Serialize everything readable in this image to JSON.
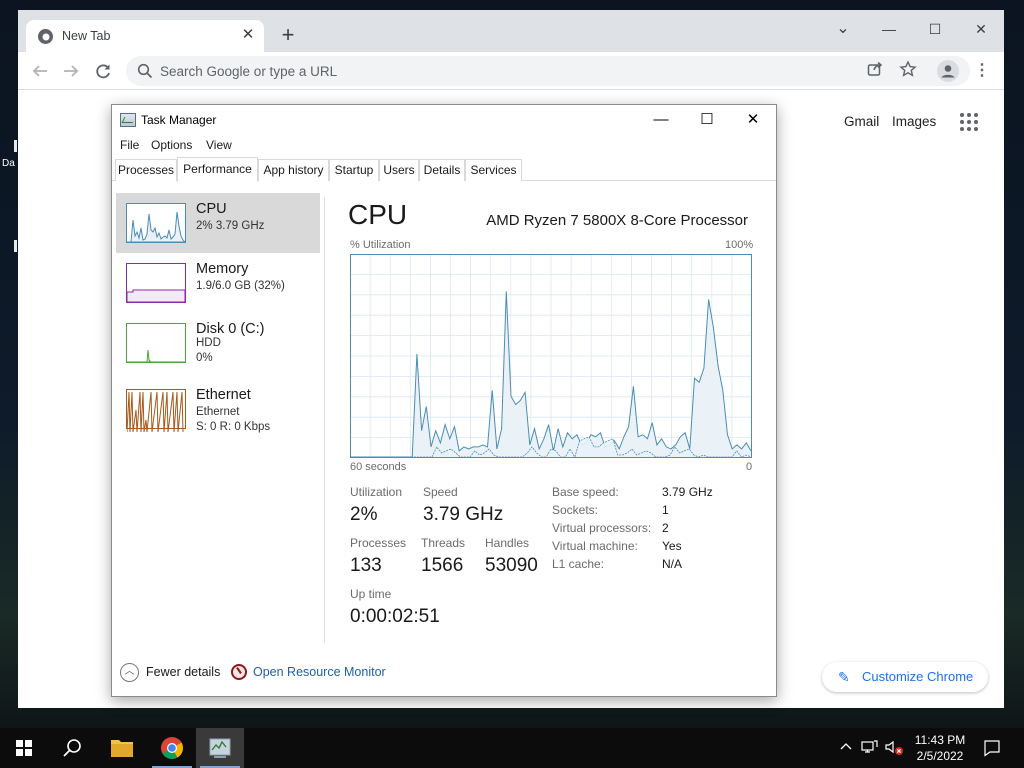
{
  "desktop": {
    "fragment_text": "Da"
  },
  "chrome": {
    "tab_title": "New Tab",
    "tab_close": "✕",
    "new_tab": "+",
    "omnibox_placeholder": "Search Google or type a URL",
    "links": {
      "gmail": "Gmail",
      "images": "Images"
    },
    "customize_label": "Customize Chrome",
    "window_controls": {
      "dropdown": "⌄",
      "minimize": "—",
      "maximize": "☐",
      "close": "✕"
    }
  },
  "task_manager": {
    "title": "Task Manager",
    "menu": [
      "File",
      "Options",
      "View"
    ],
    "tabs": [
      "Processes",
      "Performance",
      "App history",
      "Startup",
      "Users",
      "Details",
      "Services"
    ],
    "active_tab": "Performance",
    "sidebar": [
      {
        "name": "CPU",
        "sub1": "2%  3.79 GHz",
        "sub2": ""
      },
      {
        "name": "Memory",
        "sub1": "1.9/6.0 GB (32%)",
        "sub2": ""
      },
      {
        "name": "Disk 0 (C:)",
        "sub1": "HDD",
        "sub2": "0%"
      },
      {
        "name": "Ethernet",
        "sub1": "Ethernet",
        "sub2": "S: 0 R: 0 Kbps"
      }
    ],
    "cpu": {
      "title": "CPU",
      "model": "AMD Ryzen 7 5800X 8-Core Processor",
      "graph_ylabel": "% Utilization",
      "graph_ymax_label": "100%",
      "graph_xleft_label": "60 seconds",
      "graph_xright_label": "0",
      "stats": {
        "utilization_label": "Utilization",
        "utilization": "2%",
        "speed_label": "Speed",
        "speed": "3.79 GHz",
        "processes_label": "Processes",
        "processes": "133",
        "threads_label": "Threads",
        "threads": "1566",
        "handles_label": "Handles",
        "handles": "53090",
        "uptime_label": "Up time",
        "uptime": "0:00:02:51"
      },
      "details": [
        {
          "label": "Base speed:",
          "value": "3.79 GHz"
        },
        {
          "label": "Sockets:",
          "value": "1"
        },
        {
          "label": "Virtual processors:",
          "value": "2"
        },
        {
          "label": "Virtual machine:",
          "value": "Yes"
        },
        {
          "label": "L1 cache:",
          "value": "N/A"
        }
      ]
    },
    "footer": {
      "fewer_details": "Fewer details",
      "resource_monitor": "Open Resource Monitor"
    }
  },
  "taskbar": {
    "time": "11:43 PM",
    "date": "2/5/2022"
  },
  "colors": {
    "cpu_line": "#4a8db5",
    "cpu_fill": "#eaf2f8",
    "memory": "#8b2aa7",
    "disk": "#4ca33c",
    "ethernet": "#a65a1c",
    "link": "#1a73e8"
  },
  "chart_data": {
    "type": "area",
    "ylabel": "% Utilization",
    "xlabel": "60 seconds",
    "ylim": [
      0,
      100
    ],
    "series": [
      {
        "name": "",
        "values": [
          0,
          0,
          0,
          0,
          0,
          0,
          0,
          0,
          0,
          0,
          0,
          0,
          0,
          0,
          51,
          13,
          25,
          5,
          13,
          7,
          16,
          9,
          15,
          3,
          5,
          4,
          5,
          5,
          6,
          5,
          33,
          4,
          14,
          82,
          30,
          26,
          28,
          32,
          6,
          14,
          4,
          9,
          16,
          3,
          14,
          5,
          12,
          9,
          11,
          6,
          7,
          11,
          10,
          12,
          5,
          6,
          8,
          4,
          10,
          15,
          35,
          10,
          11,
          9,
          17,
          6,
          9,
          5,
          4,
          6,
          10,
          12,
          4,
          39,
          37,
          44,
          78,
          64,
          45,
          33,
          11,
          4,
          6,
          4,
          7,
          3
        ]
      },
      {
        "name": "",
        "values": [
          0,
          0,
          0,
          0,
          0,
          0,
          0,
          0,
          0,
          0,
          0,
          0,
          0,
          0,
          0,
          0,
          0,
          0,
          5,
          2,
          3,
          4,
          2,
          0,
          0,
          0,
          3,
          1,
          2,
          4,
          1,
          0,
          0,
          0,
          0,
          0,
          0,
          2,
          5,
          2,
          0,
          0,
          4,
          3,
          0,
          0,
          4,
          0,
          8,
          9,
          10,
          5,
          5,
          7,
          8,
          9,
          1,
          1,
          2,
          4,
          1,
          2,
          3,
          2,
          0,
          0,
          0,
          1,
          5,
          2,
          3,
          4,
          1,
          0,
          1,
          0,
          0,
          0,
          0,
          0,
          0,
          3,
          0,
          1,
          0
        ]
      }
    ]
  }
}
